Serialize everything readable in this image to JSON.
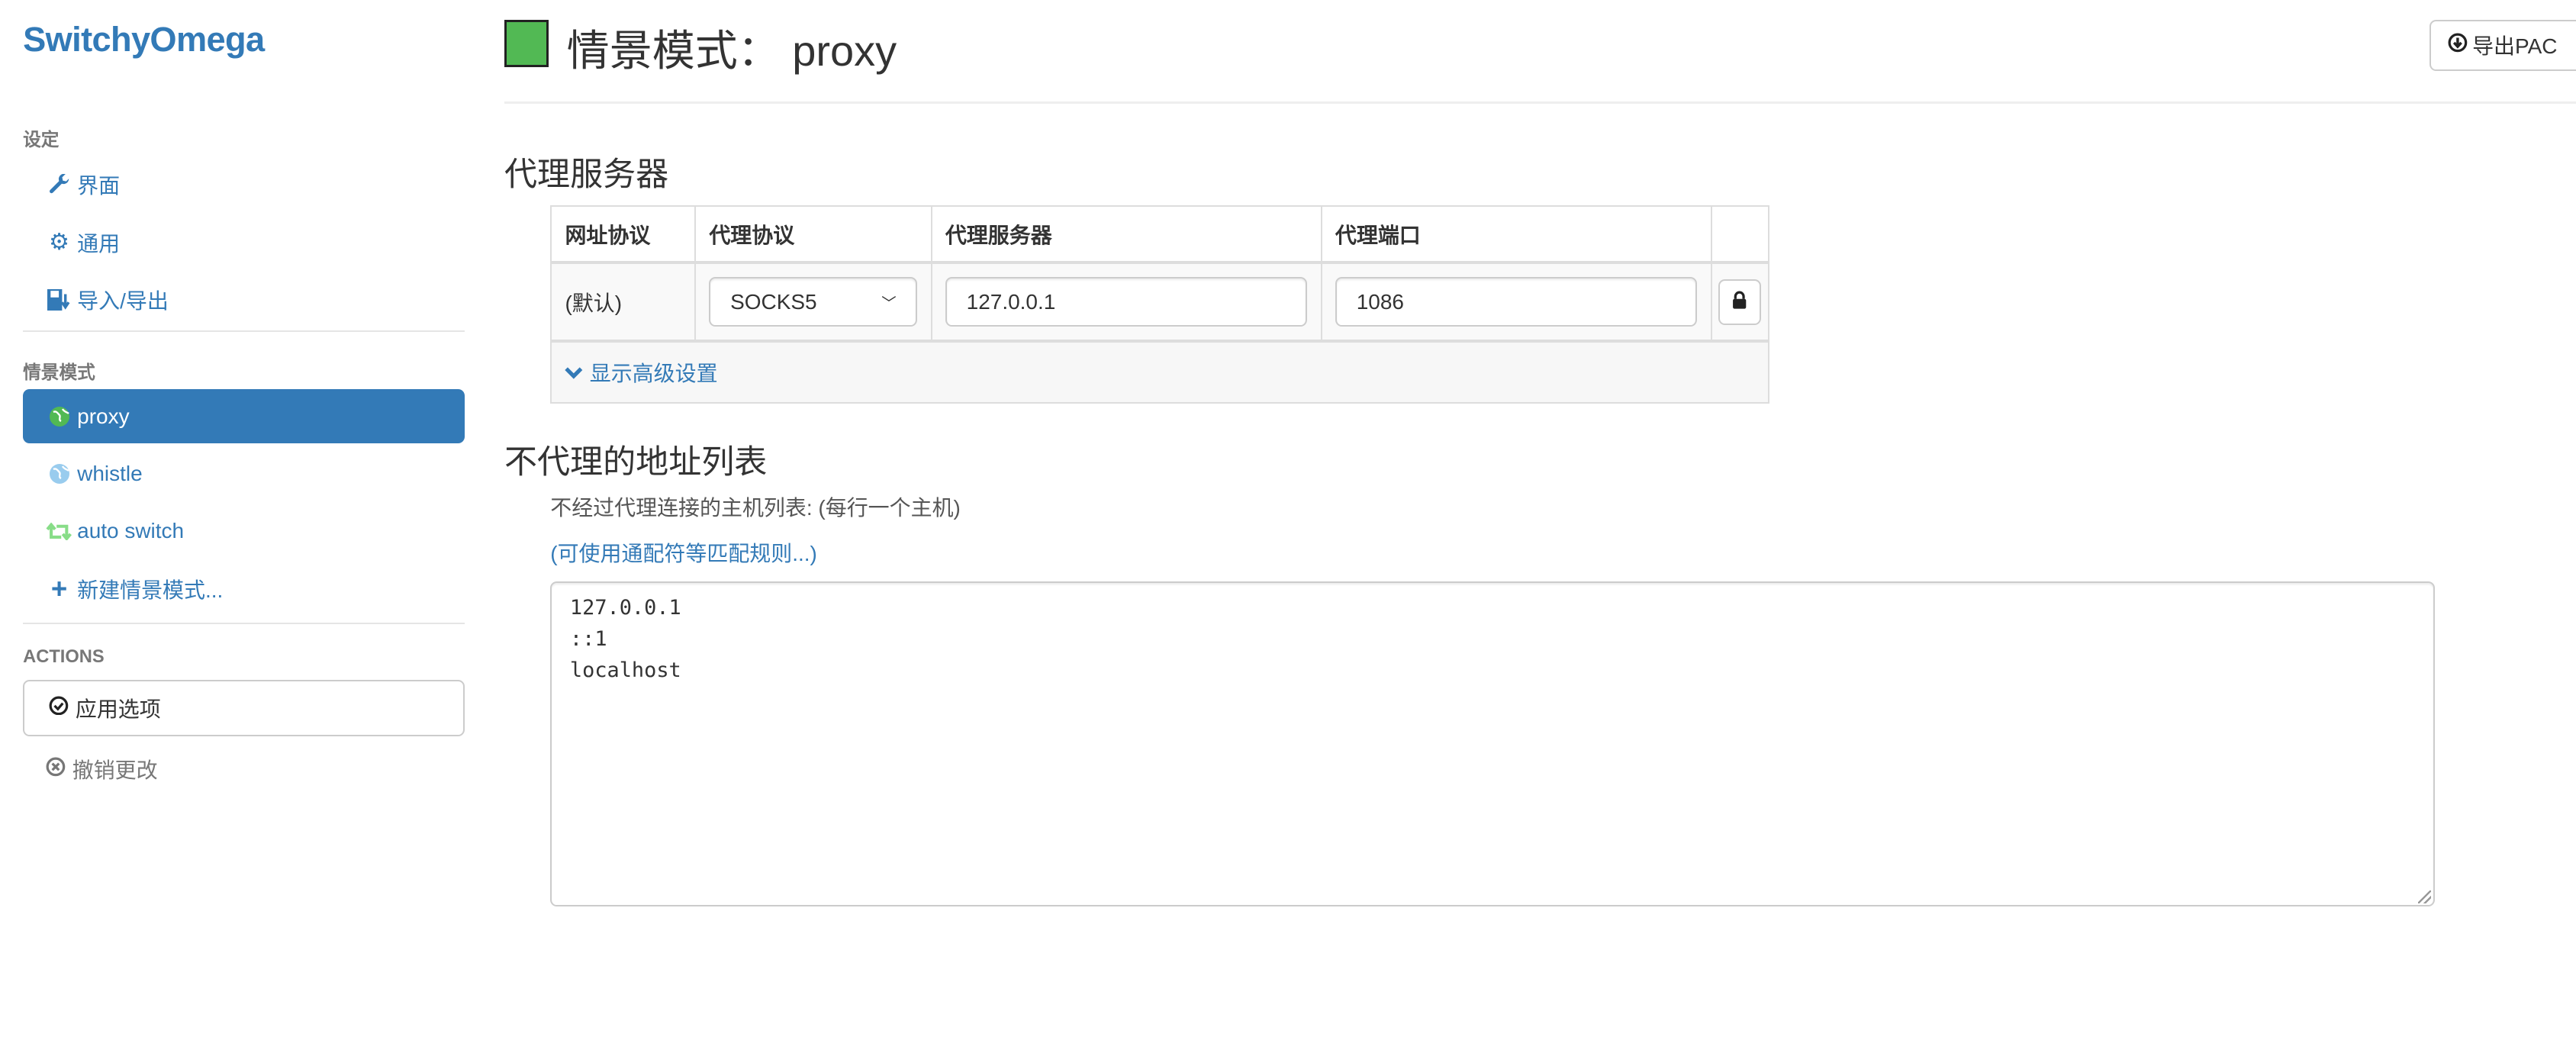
{
  "app": {
    "logo": "SwitchyOmega"
  },
  "sidebar": {
    "settings_header": "设定",
    "settings_items": [
      {
        "label": "界面",
        "icon": "wrench-icon"
      },
      {
        "label": "通用",
        "icon": "gear-icon"
      },
      {
        "label": "导入/导出",
        "icon": "floppy-import-export-icon"
      }
    ],
    "profiles_header": "情景模式",
    "profiles": [
      {
        "label": "proxy",
        "icon": "globe-icon",
        "icon_color": "#52b954",
        "active": true
      },
      {
        "label": "whistle",
        "icon": "globe-icon",
        "icon_color": "#99ccee",
        "active": false
      },
      {
        "label": "auto switch",
        "icon": "retweet-icon",
        "icon_color": "#99dd99",
        "active": false
      }
    ],
    "new_profile": "新建情景模式...",
    "actions_header": "ACTIONS",
    "apply": "应用选项",
    "revert": "撤销更改"
  },
  "header": {
    "title_prefix": "情景模式：",
    "profile_name": "proxy",
    "profile_color": "#52b954",
    "export_pac": "导出PAC"
  },
  "proxy_section": {
    "title": "代理服务器",
    "columns": [
      "网址协议",
      "代理协议",
      "代理服务器",
      "代理端口"
    ],
    "row": {
      "scheme": "(默认)",
      "protocol": "SOCKS5",
      "server": "127.0.0.1",
      "port": "1086"
    },
    "advanced": "显示高级设置"
  },
  "bypass_section": {
    "title": "不代理的地址列表",
    "help": "不经过代理连接的主机列表: (每行一个主机)",
    "rules_link": "(可使用通配符等匹配规则...)",
    "list": "127.0.0.1\n::1\nlocalhost"
  },
  "colors": {
    "accent": "#337ab7"
  }
}
